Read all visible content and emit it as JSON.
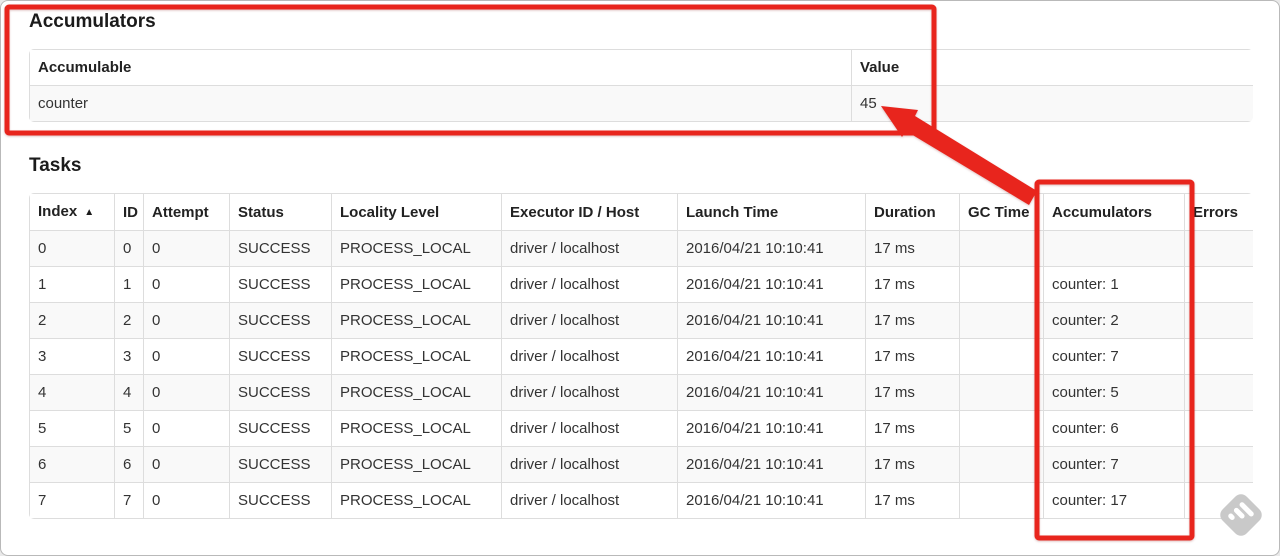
{
  "annotation": {
    "color": "#e8251d"
  },
  "watermark": {
    "icon": "feedly-logo"
  },
  "accumulators_section": {
    "title": "Accumulators",
    "table": {
      "headers": [
        "Accumulable",
        "Value"
      ],
      "rows": [
        [
          "counter",
          "45"
        ]
      ]
    }
  },
  "tasks_section": {
    "title": "Tasks",
    "table": {
      "headers": [
        "Index",
        "ID",
        "Attempt",
        "Status",
        "Locality Level",
        "Executor ID / Host",
        "Launch Time",
        "Duration",
        "GC Time",
        "Accumulators",
        "Errors"
      ],
      "sort_indicator": "▲",
      "rows": [
        [
          "0",
          "0",
          "0",
          "SUCCESS",
          "PROCESS_LOCAL",
          "driver / localhost",
          "2016/04/21 10:10:41",
          "17 ms",
          "",
          "",
          ""
        ],
        [
          "1",
          "1",
          "0",
          "SUCCESS",
          "PROCESS_LOCAL",
          "driver / localhost",
          "2016/04/21 10:10:41",
          "17 ms",
          "",
          "counter: 1",
          ""
        ],
        [
          "2",
          "2",
          "0",
          "SUCCESS",
          "PROCESS_LOCAL",
          "driver / localhost",
          "2016/04/21 10:10:41",
          "17 ms",
          "",
          "counter: 2",
          ""
        ],
        [
          "3",
          "3",
          "0",
          "SUCCESS",
          "PROCESS_LOCAL",
          "driver / localhost",
          "2016/04/21 10:10:41",
          "17 ms",
          "",
          "counter: 7",
          ""
        ],
        [
          "4",
          "4",
          "0",
          "SUCCESS",
          "PROCESS_LOCAL",
          "driver / localhost",
          "2016/04/21 10:10:41",
          "17 ms",
          "",
          "counter: 5",
          ""
        ],
        [
          "5",
          "5",
          "0",
          "SUCCESS",
          "PROCESS_LOCAL",
          "driver / localhost",
          "2016/04/21 10:10:41",
          "17 ms",
          "",
          "counter: 6",
          ""
        ],
        [
          "6",
          "6",
          "0",
          "SUCCESS",
          "PROCESS_LOCAL",
          "driver / localhost",
          "2016/04/21 10:10:41",
          "17 ms",
          "",
          "counter: 7",
          ""
        ],
        [
          "7",
          "7",
          "0",
          "SUCCESS",
          "PROCESS_LOCAL",
          "driver / localhost",
          "2016/04/21 10:10:41",
          "17 ms",
          "",
          "counter: 17",
          ""
        ]
      ]
    }
  }
}
